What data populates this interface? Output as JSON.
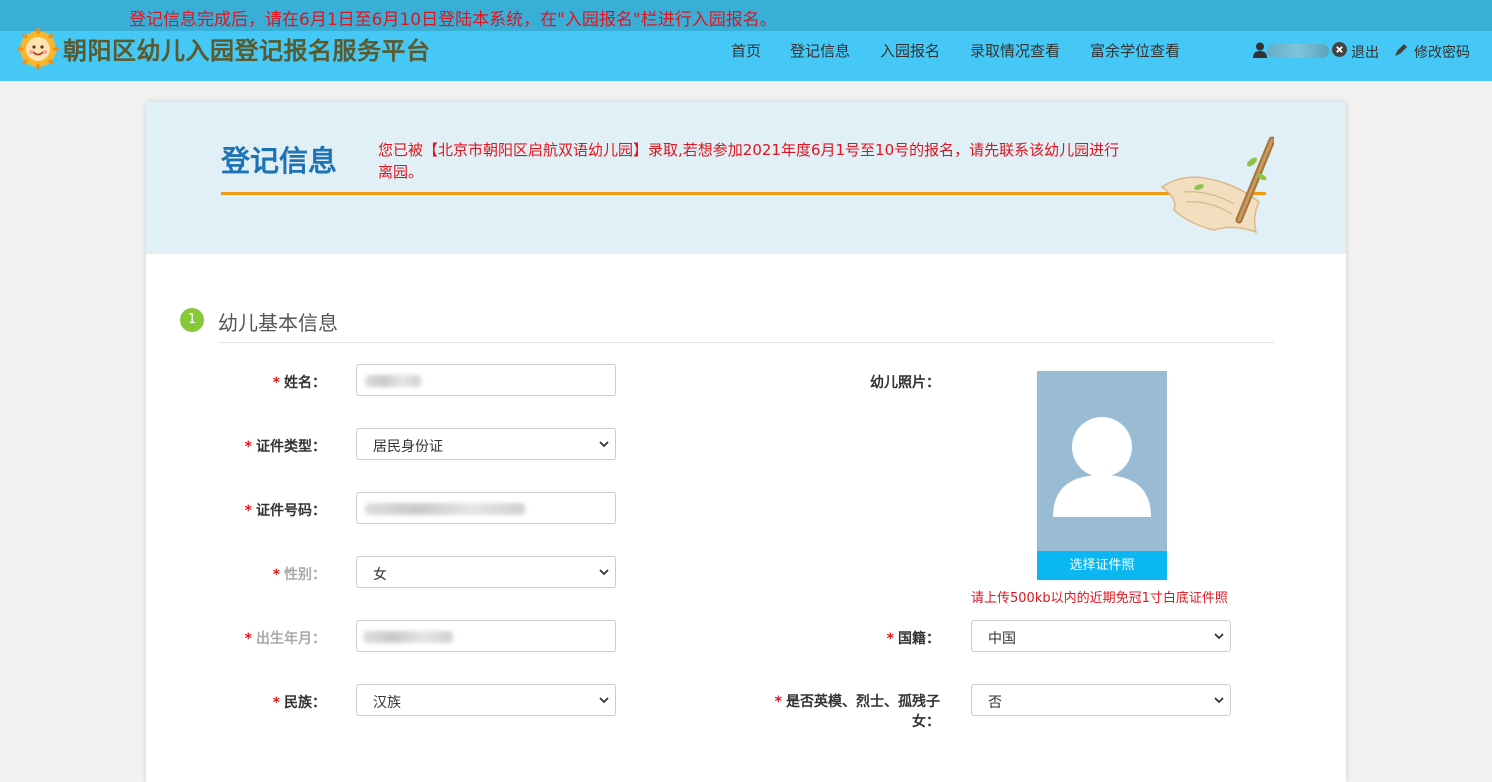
{
  "notice": "登记信息完成后，请在6月1日至6月10日登陆本系统，在\"入园报名\"栏进行入园报名。",
  "site_title": "朝阳区幼儿入园登记报名服务平台",
  "nav": [
    "首页",
    "登记信息",
    "入园报名",
    "录取情况查看",
    "富余学位查看"
  ],
  "user": {
    "logout": "退出",
    "change_password": "修改密码"
  },
  "banner": {
    "title": "登记信息",
    "message": "您已被【北京市朝阳区启航双语幼儿园】录取,若想参加2021年度6月1号至10号的报名，请先联系该幼儿园进行离园。"
  },
  "section": {
    "number": "1",
    "title": "幼儿基本信息"
  },
  "form": {
    "required_mark": "*",
    "name_label": "姓名：",
    "id_type_label": "证件类型：",
    "id_type_value": "居民身份证",
    "id_number_label": "证件号码：",
    "gender_label": "性别：",
    "gender_value": "女",
    "birth_label": "出生年月：",
    "ethnicity_label": "民族：",
    "ethnicity_value": "汉族",
    "photo_label": "幼儿照片：",
    "photo_button": "选择证件照",
    "photo_hint": "请上传500kb以内的近期免冠1寸白底证件照",
    "nationality_label": "国籍：",
    "nationality_value": "中国",
    "hero_label_line1": "是否英模、烈士、孤残子",
    "hero_label_line2": "女：",
    "hero_value": "否"
  },
  "colors": {
    "header_bg": "#45c8f5",
    "notice_strip": "#39afd8",
    "alert_red": "#e0141e",
    "banner_bg": "#e0f0f6",
    "banner_title": "#1f73b4",
    "divider_orange": "#f39b10",
    "step_green": "#86c838",
    "photo_button": "#0ab7f0"
  },
  "icons": [
    "sun-logo-icon",
    "user-icon",
    "logout-icon",
    "edit-icon",
    "scroll-quill-icon",
    "avatar-placeholder-icon",
    "chevron-down-icon"
  ]
}
